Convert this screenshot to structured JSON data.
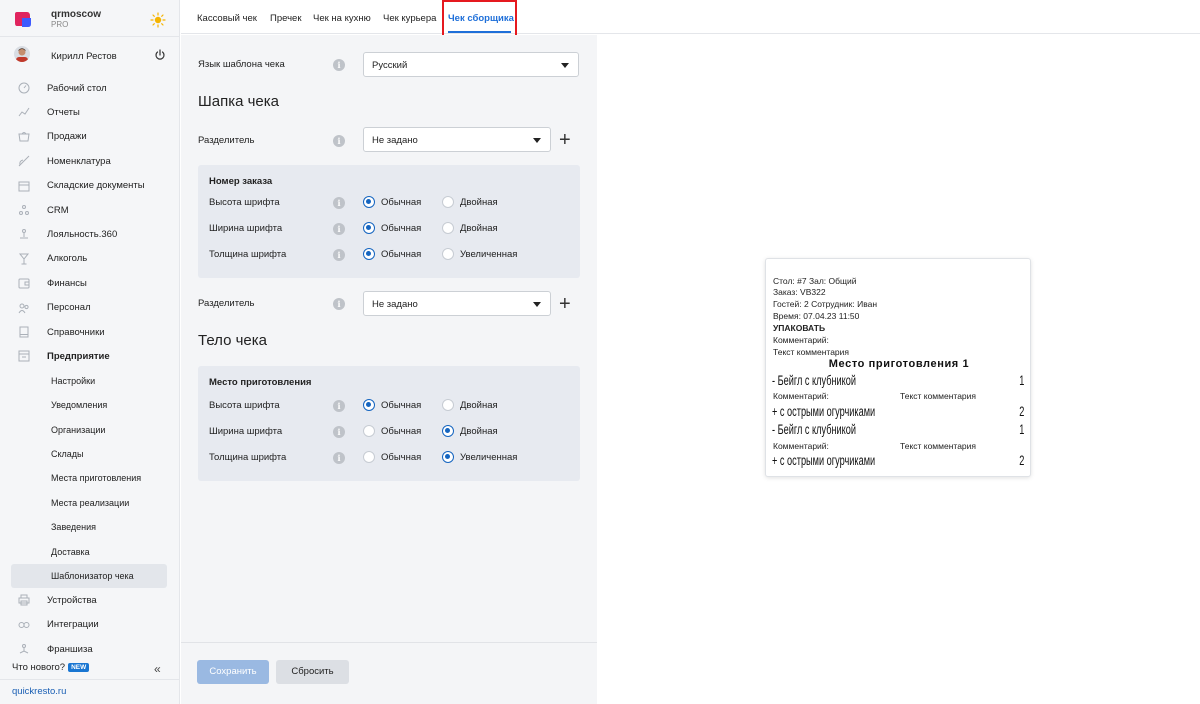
{
  "brand": {
    "name": "qrmoscow",
    "plan": "PRO"
  },
  "user": {
    "name": "Кирилл Рестов"
  },
  "menu": [
    {
      "label": "Рабочий стол",
      "icon": "dashboard-icon"
    },
    {
      "label": "Отчеты",
      "icon": "chart-icon"
    },
    {
      "label": "Продажи",
      "icon": "cart-icon"
    },
    {
      "label": "Номенклатура",
      "icon": "tag-icon"
    },
    {
      "label": "Складские документы",
      "icon": "box-icon"
    },
    {
      "label": "CRM",
      "icon": "people-icon"
    },
    {
      "label": "Лояльность.360",
      "icon": "loyalty-icon"
    },
    {
      "label": "Алкоголь",
      "icon": "glass-icon"
    },
    {
      "label": "Финансы",
      "icon": "wallet-icon"
    },
    {
      "label": "Персонал",
      "icon": "staff-icon"
    },
    {
      "label": "Справочники",
      "icon": "book-icon"
    },
    {
      "label": "Предприятие",
      "icon": "enterprise-icon"
    }
  ],
  "submenu": [
    {
      "label": "Настройки"
    },
    {
      "label": "Уведомления"
    },
    {
      "label": "Организации"
    },
    {
      "label": "Склады"
    },
    {
      "label": "Места приготовления"
    },
    {
      "label": "Места реализации"
    },
    {
      "label": "Заведения"
    },
    {
      "label": "Доставка"
    },
    {
      "label": "Шаблонизатор чека"
    }
  ],
  "menu_bottom": [
    {
      "label": "Устройства",
      "icon": "printer-icon"
    },
    {
      "label": "Интеграции",
      "icon": "link-icon"
    },
    {
      "label": "Франшиза",
      "icon": "franchise-icon"
    }
  ],
  "footer": {
    "whats_new": "Что нового?",
    "badge": "NEW",
    "site": "quickresto.ru"
  },
  "tabs": [
    {
      "label": "Кассовый чек"
    },
    {
      "label": "Пречек"
    },
    {
      "label": "Чек на кухню"
    },
    {
      "label": "Чек курьера"
    },
    {
      "label": "Чек сборщика"
    }
  ],
  "form": {
    "language_label": "Язык шаблона чека",
    "language_value": "Русский",
    "header_title": "Шапка чека",
    "separator_label": "Разделитель",
    "separator_value": "Не задано",
    "order_group_title": "Номер заказа",
    "body_title": "Тело чека",
    "place_group_title": "Место приготовления",
    "font_height": "Высота шрифта",
    "font_width": "Ширина шрифта",
    "font_weight": "Толщина шрифта",
    "opt_normal": "Обычная",
    "opt_double": "Двойная",
    "opt_increased": "Увеличенная",
    "save": "Сохранить",
    "reset": "Сбросить"
  },
  "receipt": {
    "line1": "Стол: #7 Зал: Общий",
    "line2": "Заказ: VB322",
    "line3": "Гостей: 2 Сотрудник: Иван",
    "line4": "Время: 07.04.23 11:50",
    "line5": "УПАКОВАТЬ",
    "line6": "Комментарий:",
    "line7": "Текст комментария",
    "place": "Место приготовления 1",
    "item1": "- Бейгл с клубникой",
    "item1_qty": "1",
    "comment_label": "Комментарий:",
    "comment_value": "Текст комментария",
    "mod1": "+ с острыми огурчиками",
    "mod1_qty": "2",
    "item2": "- Бейгл с клубникой",
    "item2_qty": "1",
    "mod2": "+ с острыми огурчиками",
    "mod2_qty": "2"
  },
  "colors": {
    "accent": "#1e6fd9",
    "highlight": "#e5191f",
    "brand": "#e0245e"
  }
}
